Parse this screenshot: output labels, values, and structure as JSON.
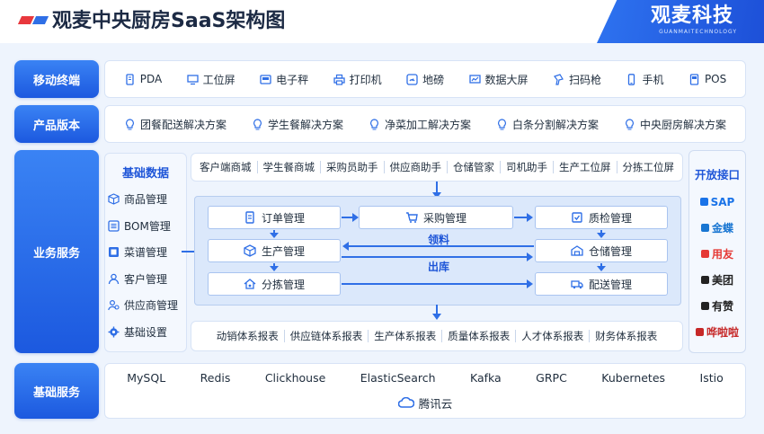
{
  "header": {
    "title": "观麦中央厨房SaaS架构图",
    "brand_name": "观麦科技",
    "brand_sub": "GUANMAITECHNOLOGY"
  },
  "rows": {
    "mobile_label": "移动终端",
    "product_label": "产品版本",
    "business_label": "业务服务",
    "infra_label": "基础服务"
  },
  "mobile_items": [
    {
      "label": "PDA",
      "icon": "pda-icon"
    },
    {
      "label": "工位屏",
      "icon": "monitor-icon"
    },
    {
      "label": "电子秤",
      "icon": "scale-icon"
    },
    {
      "label": "打印机",
      "icon": "printer-icon"
    },
    {
      "label": "地磅",
      "icon": "weighbridge-icon"
    },
    {
      "label": "数据大屏",
      "icon": "dashboard-icon"
    },
    {
      "label": "扫码枪",
      "icon": "scanner-icon"
    },
    {
      "label": "手机",
      "icon": "phone-icon"
    },
    {
      "label": "POS",
      "icon": "pos-icon"
    }
  ],
  "product_items": [
    "团餐配送解决方案",
    "学生餐解决方案",
    "净菜加工解决方案",
    "白条分割解决方案",
    "中央厨房解决方案"
  ],
  "basic_data": {
    "title": "基础数据",
    "items": [
      {
        "label": "商品管理",
        "icon": "cube-icon"
      },
      {
        "label": "BOM管理",
        "icon": "list-icon"
      },
      {
        "label": "菜谱管理",
        "icon": "recipe-icon"
      },
      {
        "label": "客户管理",
        "icon": "user-icon"
      },
      {
        "label": "供应商管理",
        "icon": "supplier-icon"
      },
      {
        "label": "基础设置",
        "icon": "gear-icon"
      }
    ]
  },
  "apps": [
    "客户端商城",
    "学生餐商城",
    "采购员助手",
    "供应商助手",
    "仓储管家",
    "司机助手",
    "生产工位屏",
    "分拣工位屏"
  ],
  "modules": {
    "order": "订单管理",
    "purchase": "采购管理",
    "qc": "质检管理",
    "production": "生产管理",
    "warehouse": "仓储管理",
    "sorting": "分拣管理",
    "delivery": "配送管理",
    "pick_label": "领料",
    "outbound_label": "出库"
  },
  "reports": [
    "动销体系报表",
    "供应链体系报表",
    "生产体系报表",
    "质量体系报表",
    "人才体系报表",
    "财务体系报表"
  ],
  "open_api": {
    "title": "开放接口",
    "logos": [
      {
        "label": "SAP",
        "color": "#1a73e8"
      },
      {
        "label": "金蝶",
        "color": "#1976d2"
      },
      {
        "label": "用友",
        "color": "#e53935"
      },
      {
        "label": "美团",
        "color": "#222222"
      },
      {
        "label": "有赞",
        "color": "#222222"
      },
      {
        "label": "哗啦啦",
        "color": "#c62828"
      }
    ]
  },
  "infra": {
    "items": [
      "MySQL",
      "Redis",
      "Clickhouse",
      "ElasticSearch",
      "Kafka",
      "GRPC",
      "Kubernetes",
      "Istio"
    ],
    "cloud": "腾讯云"
  },
  "colors": {
    "primary": "#2f6fe6",
    "accent_red": "#e8383d"
  }
}
